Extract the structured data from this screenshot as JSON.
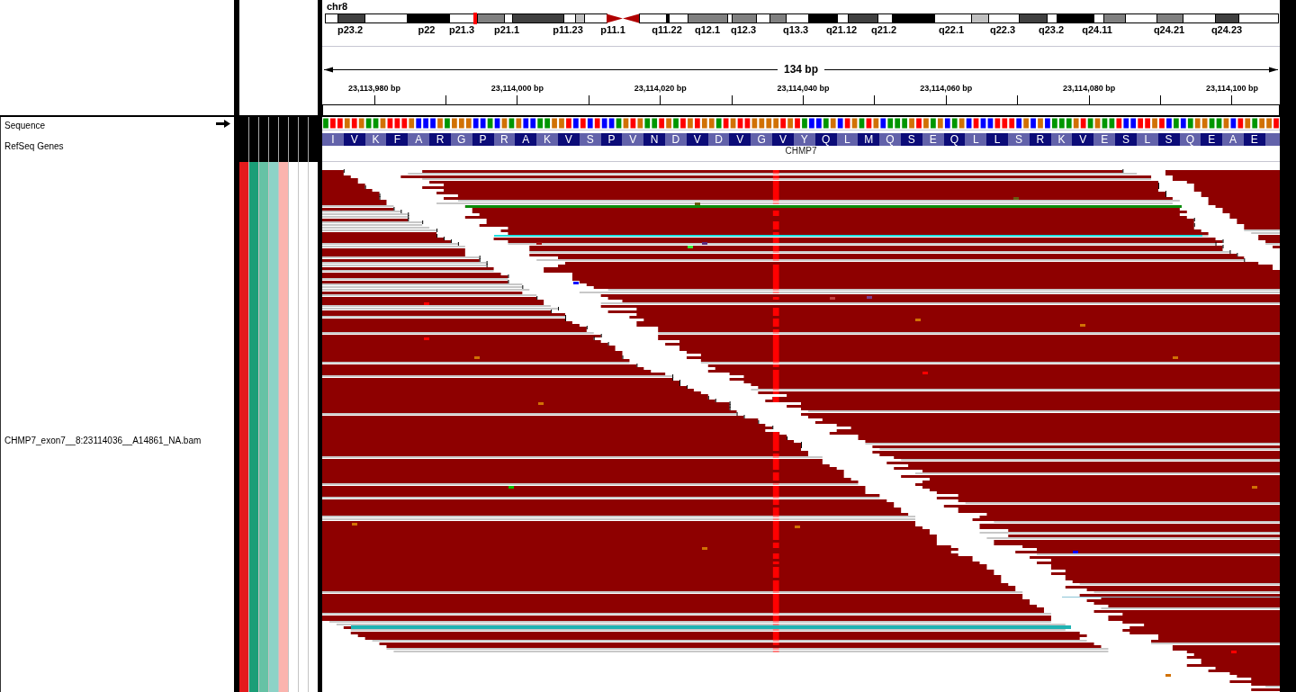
{
  "ideogram": {
    "chromosome": "chr8",
    "band_labels": [
      "p23.2",
      "p22",
      "p21.3",
      "p21.1",
      "p11.23",
      "p11.1",
      "q11.22",
      "q12.1",
      "q12.3",
      "q13.3",
      "q21.12",
      "q21.2",
      "q22.1",
      "q22.3",
      "q23.2",
      "q24.11",
      "q24.21",
      "q24.23"
    ]
  },
  "ruler": {
    "span": "134 bp",
    "tick_labels": [
      "23,113,980 bp",
      "23,114,000 bp",
      "23,114,020 bp",
      "23,114,040 bp",
      "23,114,060 bp",
      "23,114,080 bp",
      "23,114,100 bp"
    ]
  },
  "tracks": [
    {
      "kind": "sequence",
      "name": "Sequence",
      "forward_strand": true,
      "bases": [
        {
          "color": "#009600"
        },
        {
          "color": "#ff0000"
        },
        {
          "color": "#ff0000"
        },
        {
          "color": "#d17105"
        },
        {
          "color": "#ff0000"
        },
        {
          "color": "#d17105"
        },
        {
          "color": "#009600"
        },
        {
          "color": "#009600"
        },
        {
          "color": "#d17105"
        },
        {
          "color": "#ff0000"
        },
        {
          "color": "#ff0000"
        },
        {
          "color": "#ff0000"
        },
        {
          "color": "#d17105"
        },
        {
          "color": "#0000ff"
        },
        {
          "color": "#0000ff"
        },
        {
          "color": "#0000ff"
        },
        {
          "color": "#d17105"
        },
        {
          "color": "#009600"
        },
        {
          "color": "#d17105"
        },
        {
          "color": "#d17105"
        },
        {
          "color": "#d17105"
        },
        {
          "color": "#0000ff"
        },
        {
          "color": "#0000ff"
        },
        {
          "color": "#009600"
        },
        {
          "color": "#0000ff"
        },
        {
          "color": "#d17105"
        },
        {
          "color": "#009600"
        },
        {
          "color": "#d17105"
        },
        {
          "color": "#0000ff"
        },
        {
          "color": "#0000ff"
        },
        {
          "color": "#009600"
        },
        {
          "color": "#009600"
        },
        {
          "color": "#d17105"
        },
        {
          "color": "#d17105"
        },
        {
          "color": "#ff0000"
        },
        {
          "color": "#0000ff"
        },
        {
          "color": "#ff0000"
        },
        {
          "color": "#0000ff"
        },
        {
          "color": "#ff0000"
        },
        {
          "color": "#0000ff"
        },
        {
          "color": "#0000ff"
        },
        {
          "color": "#009600"
        },
        {
          "color": "#d17105"
        },
        {
          "color": "#ff0000"
        },
        {
          "color": "#d17105"
        },
        {
          "color": "#009600"
        },
        {
          "color": "#009600"
        },
        {
          "color": "#ff0000"
        },
        {
          "color": "#d17105"
        },
        {
          "color": "#009600"
        },
        {
          "color": "#ff0000"
        },
        {
          "color": "#d17105"
        },
        {
          "color": "#ff0000"
        },
        {
          "color": "#d17105"
        },
        {
          "color": "#d17105"
        },
        {
          "color": "#009600"
        },
        {
          "color": "#ff0000"
        },
        {
          "color": "#d17105"
        },
        {
          "color": "#ff0000"
        },
        {
          "color": "#ff0000"
        },
        {
          "color": "#d17105"
        },
        {
          "color": "#d17105"
        },
        {
          "color": "#d17105"
        },
        {
          "color": "#d17105"
        },
        {
          "color": "#ff0000"
        },
        {
          "color": "#d17105"
        },
        {
          "color": "#ff0000"
        },
        {
          "color": "#009600"
        },
        {
          "color": "#0000ff"
        },
        {
          "color": "#0000ff"
        },
        {
          "color": "#009600"
        },
        {
          "color": "#d17105"
        },
        {
          "color": "#0000ff"
        },
        {
          "color": "#ff0000"
        },
        {
          "color": "#d17105"
        },
        {
          "color": "#009600"
        },
        {
          "color": "#ff0000"
        },
        {
          "color": "#d17105"
        },
        {
          "color": "#0000ff"
        },
        {
          "color": "#009600"
        },
        {
          "color": "#009600"
        },
        {
          "color": "#009600"
        },
        {
          "color": "#d17105"
        },
        {
          "color": "#ff0000"
        },
        {
          "color": "#d17105"
        },
        {
          "color": "#009600"
        },
        {
          "color": "#d17105"
        },
        {
          "color": "#0000ff"
        },
        {
          "color": "#009600"
        },
        {
          "color": "#d17105"
        },
        {
          "color": "#0000ff"
        },
        {
          "color": "#ff0000"
        },
        {
          "color": "#0000ff"
        },
        {
          "color": "#0000ff"
        },
        {
          "color": "#ff0000"
        },
        {
          "color": "#ff0000"
        },
        {
          "color": "#ff0000"
        },
        {
          "color": "#0000ff"
        },
        {
          "color": "#d17105"
        },
        {
          "color": "#0000ff"
        },
        {
          "color": "#d17105"
        },
        {
          "color": "#0000ff"
        },
        {
          "color": "#009600"
        },
        {
          "color": "#009600"
        },
        {
          "color": "#009600"
        },
        {
          "color": "#d17105"
        },
        {
          "color": "#ff0000"
        },
        {
          "color": "#009600"
        },
        {
          "color": "#d17105"
        },
        {
          "color": "#009600"
        },
        {
          "color": "#009600"
        },
        {
          "color": "#ff0000"
        },
        {
          "color": "#0000ff"
        },
        {
          "color": "#0000ff"
        },
        {
          "color": "#ff0000"
        },
        {
          "color": "#ff0000"
        },
        {
          "color": "#d17105"
        },
        {
          "color": "#ff0000"
        },
        {
          "color": "#0000ff"
        },
        {
          "color": "#009600"
        },
        {
          "color": "#0000ff"
        },
        {
          "color": "#009600"
        },
        {
          "color": "#d17105"
        },
        {
          "color": "#d17105"
        },
        {
          "color": "#009600"
        },
        {
          "color": "#009600"
        },
        {
          "color": "#d17105"
        },
        {
          "color": "#0000ff"
        },
        {
          "color": "#ff0000"
        },
        {
          "color": "#d17105"
        },
        {
          "color": "#009600"
        },
        {
          "color": "#d17105"
        },
        {
          "color": "#d17105"
        },
        {
          "color": "#ff0000"
        }
      ]
    },
    {
      "kind": "gene",
      "name": "RefSeq Genes",
      "gene": "CHMP7",
      "amino_acids": [
        "I",
        "V",
        "K",
        "F",
        "A",
        "R",
        "G",
        "P",
        "R",
        "A",
        "K",
        "V",
        "S",
        "P",
        "V",
        "N",
        "D",
        "V",
        "D",
        "V",
        "G",
        "V",
        "Y",
        "Q",
        "L",
        "M",
        "Q",
        "S",
        "E",
        "Q",
        "L",
        "L",
        "S",
        "R",
        "K",
        "V",
        "E",
        "S",
        "L",
        "S",
        "Q",
        "E",
        "A",
        "E"
      ]
    },
    {
      "kind": "alignment",
      "name": "CHMP7_exon7__8:23114036__A14861_NA.bam",
      "attributes": [
        {
          "color": "#e41a1c"
        },
        {
          "color": "#1b9e77"
        },
        {
          "color": "#66c2a5"
        },
        {
          "color": "#8dd3c7"
        },
        {
          "color": "#fbb4ae"
        },
        {
          "color": "#ffffff"
        },
        {
          "color": "#ffffff"
        },
        {
          "color": "#ffffff"
        }
      ]
    }
  ]
}
